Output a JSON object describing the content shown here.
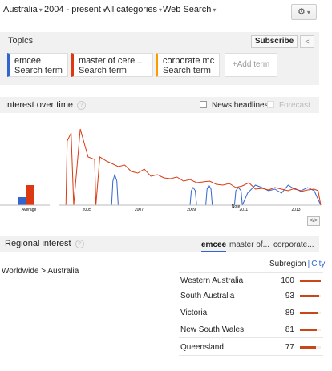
{
  "filters": {
    "region": "Australia",
    "period": "2004 - present",
    "category": "All categories",
    "search_type": "Web Search"
  },
  "topics": {
    "label": "Topics",
    "subscribe_label": "Subscribe",
    "share_icon": "share-icon",
    "terms": [
      {
        "name": "emcee",
        "kind": "Search term",
        "color": "#3366cc"
      },
      {
        "name": "master of cere...",
        "kind": "Search term",
        "color": "#dc3912"
      },
      {
        "name": "corporate mc",
        "kind": "Search term",
        "color": "#ff9900"
      }
    ],
    "add_term_label": "+Add term"
  },
  "interest": {
    "title": "Interest over time",
    "news_headlines_label": "News headlines",
    "forecast_label": "Forecast",
    "average_label": "Average",
    "note_label": "Note",
    "embed_label": "</>"
  },
  "chart_data": {
    "type": "line",
    "x_ticks": [
      "2005",
      "2007",
      "2009",
      "2011",
      "2013"
    ],
    "average": [
      {
        "name": "emcee",
        "color": "#3366cc",
        "value": 10
      },
      {
        "name": "master of cere...",
        "color": "#dc3912",
        "value": 25
      },
      {
        "name": "corporate mc",
        "color": "#ff9900",
        "value": 0
      }
    ],
    "series": [
      {
        "name": "master of cere...",
        "color": "#dc3912",
        "x": [
          2004.0,
          2004.25,
          2004.3,
          2004.45,
          2004.55,
          2004.8,
          2005.1,
          2005.35,
          2005.4,
          2005.55,
          2005.8,
          2006.0,
          2006.25,
          2006.5,
          2006.75,
          2007.0,
          2007.25,
          2007.5,
          2007.75,
          2008.0,
          2008.25,
          2008.5,
          2008.75,
          2009.0,
          2009.25,
          2009.5,
          2009.75,
          2010.0,
          2010.25,
          2010.5,
          2010.75,
          2011.0,
          2011.25,
          2011.5,
          2011.75,
          2012.0,
          2012.25,
          2012.5,
          2012.75,
          2013.0,
          2013.25,
          2013.5,
          2013.75,
          2013.9,
          2014.0
        ],
        "y": [
          0,
          0,
          80,
          90,
          0,
          95,
          60,
          57,
          0,
          60,
          55,
          52,
          48,
          50,
          42,
          40,
          45,
          36,
          38,
          34,
          33,
          35,
          30,
          32,
          28,
          29,
          30,
          26,
          25,
          27,
          22,
          24,
          28,
          20,
          21,
          19,
          22,
          20,
          18,
          21,
          17,
          19,
          20,
          18,
          0
        ]
      },
      {
        "name": "emcee",
        "color": "#3366cc",
        "x": [
          2004.0,
          2006.0,
          2006.05,
          2006.12,
          2006.2,
          2006.25,
          2009.0,
          2009.05,
          2009.12,
          2009.2,
          2009.25,
          2009.6,
          2009.65,
          2009.72,
          2009.8,
          2009.85,
          2010.7,
          2010.75,
          2010.85,
          2010.95,
          2011.0,
          2011.2,
          2011.5,
          2011.75,
          2012.0,
          2012.25,
          2012.5,
          2012.75,
          2013.0,
          2013.25,
          2013.5,
          2013.75,
          2014.0
        ],
        "y": [
          0,
          0,
          30,
          38,
          30,
          0,
          0,
          18,
          22,
          18,
          0,
          0,
          20,
          25,
          20,
          0,
          0,
          18,
          22,
          18,
          0,
          15,
          25,
          22,
          18,
          20,
          15,
          25,
          20,
          18,
          22,
          18,
          0
        ]
      },
      {
        "name": "corporate mc",
        "color": "#ff9900",
        "x": [
          2004.0,
          2014.0
        ],
        "y": [
          0,
          0
        ]
      }
    ],
    "xlim": [
      2004.0,
      2014.0
    ],
    "ylim": [
      0,
      100
    ],
    "grid": false,
    "legend": "none"
  },
  "regional": {
    "title": "Regional interest",
    "tabs": [
      "emcee",
      "master of...",
      "corporate..."
    ],
    "path": "Worldwide > Australia",
    "subregion_label": "Subregion",
    "city_label": "City",
    "rows": [
      {
        "name": "Western Australia",
        "value": 100
      },
      {
        "name": "South Australia",
        "value": 93
      },
      {
        "name": "Victoria",
        "value": 89
      },
      {
        "name": "New South Wales",
        "value": 81
      },
      {
        "name": "Queensland",
        "value": 77
      }
    ],
    "bar_color": "#c8461a"
  }
}
